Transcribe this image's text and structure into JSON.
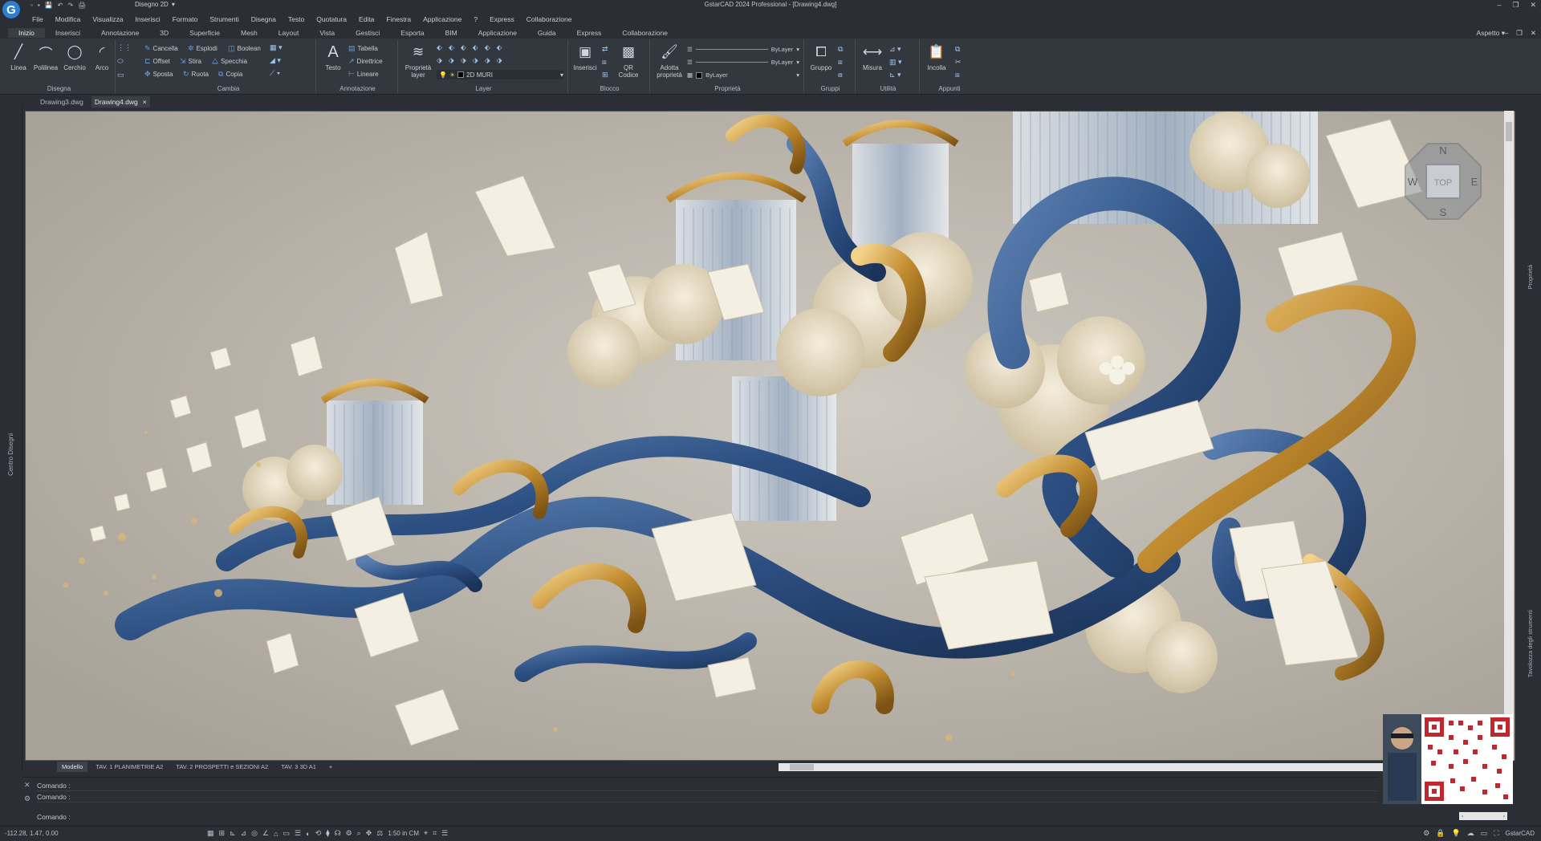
{
  "app": {
    "logo_letter": "G",
    "title": "GstarCAD 2024 Professional - [Drawing4.dwg]",
    "workspace": "Disegno 2D",
    "window_buttons": [
      "–",
      "❐",
      "✕"
    ]
  },
  "qat": [
    "▫",
    "▪",
    "💾",
    "↶",
    "↷",
    "🖨"
  ],
  "menu": [
    "File",
    "Modifica",
    "Visualizza",
    "Inserisci",
    "Formato",
    "Strumenti",
    "Disegna",
    "Testo",
    "Quotatura",
    "Edita",
    "Finestra",
    "Applicazione",
    "?",
    "Express",
    "Collaborazione"
  ],
  "ribbon_tabs": [
    "Inizio",
    "Inserisci",
    "Annotazione",
    "3D",
    "Superficie",
    "Mesh",
    "Layout",
    "Vista",
    "Gestisci",
    "Esporta",
    "BIM",
    "Applicazione",
    "Guida",
    "Express",
    "Collaborazione"
  ],
  "ribbon_tabs_active": "Inizio",
  "aspetto": "Aspetto",
  "tab_controls": [
    "–",
    "❐",
    "✕"
  ],
  "panels": {
    "draw": {
      "label": "Disegna",
      "tools": [
        "Linea",
        "Polilinea",
        "Cerchio",
        "Arco"
      ]
    },
    "modify": {
      "label": "Cambia",
      "tools": [
        "Cancella",
        "Esplodi",
        "Boolean",
        "Offset",
        "Stira",
        "Specchia",
        "Sposta",
        "Ruota",
        "Copia"
      ]
    },
    "annotation": {
      "label": "Annotazione",
      "big": "Testo",
      "tools": [
        "Tabella",
        "Direttrice",
        "Lineare"
      ]
    },
    "layer": {
      "label": "Layer",
      "big": "Proprietà layer",
      "current": "2D MURI"
    },
    "block": {
      "label": "Blocco",
      "tools": [
        "Inserisci",
        "QR Codice"
      ]
    },
    "properties": {
      "label": "Proprietà",
      "big": "Adotta proprietà",
      "values": [
        "ByLayer",
        "ByLayer",
        "ByLayer"
      ]
    },
    "groups": {
      "label": "Gruppi",
      "big": "Gruppo"
    },
    "utility": {
      "label": "Utilità",
      "big": "Misura"
    },
    "clipboard": {
      "label": "Appunti",
      "big": "Incolla"
    }
  },
  "doc_tabs": [
    "Drawing3.dwg",
    "Drawing4.dwg"
  ],
  "doc_tab_active": "Drawing4.dwg",
  "left_panel_label": "Centro Disegni",
  "right_panel_labels": [
    "Proprietà",
    "Tavolozza degli strumenti"
  ],
  "viewcube": {
    "top": "TOP",
    "n": "N",
    "s": "S",
    "e": "E",
    "w": "W"
  },
  "layout_tabs": [
    "Modello",
    "TAV. 1 PLANIMETRIE A2",
    "TAV. 2 PROSPETTI e SEZIONI A2",
    "TAV. 3 3D A1",
    "+"
  ],
  "layout_tab_active": "Modello",
  "command_lines": [
    "Comando :",
    "Comando :",
    "Comando :"
  ],
  "status": {
    "coords": "-112.28, 1.47, 0.00",
    "scale": "1:50 in CM",
    "brand": "GstarCAD"
  },
  "colors": {
    "bg": "#2b2f35",
    "ribbon": "#33383f",
    "accent": "#2d7fd6",
    "canvas": "#b9b3a9"
  }
}
